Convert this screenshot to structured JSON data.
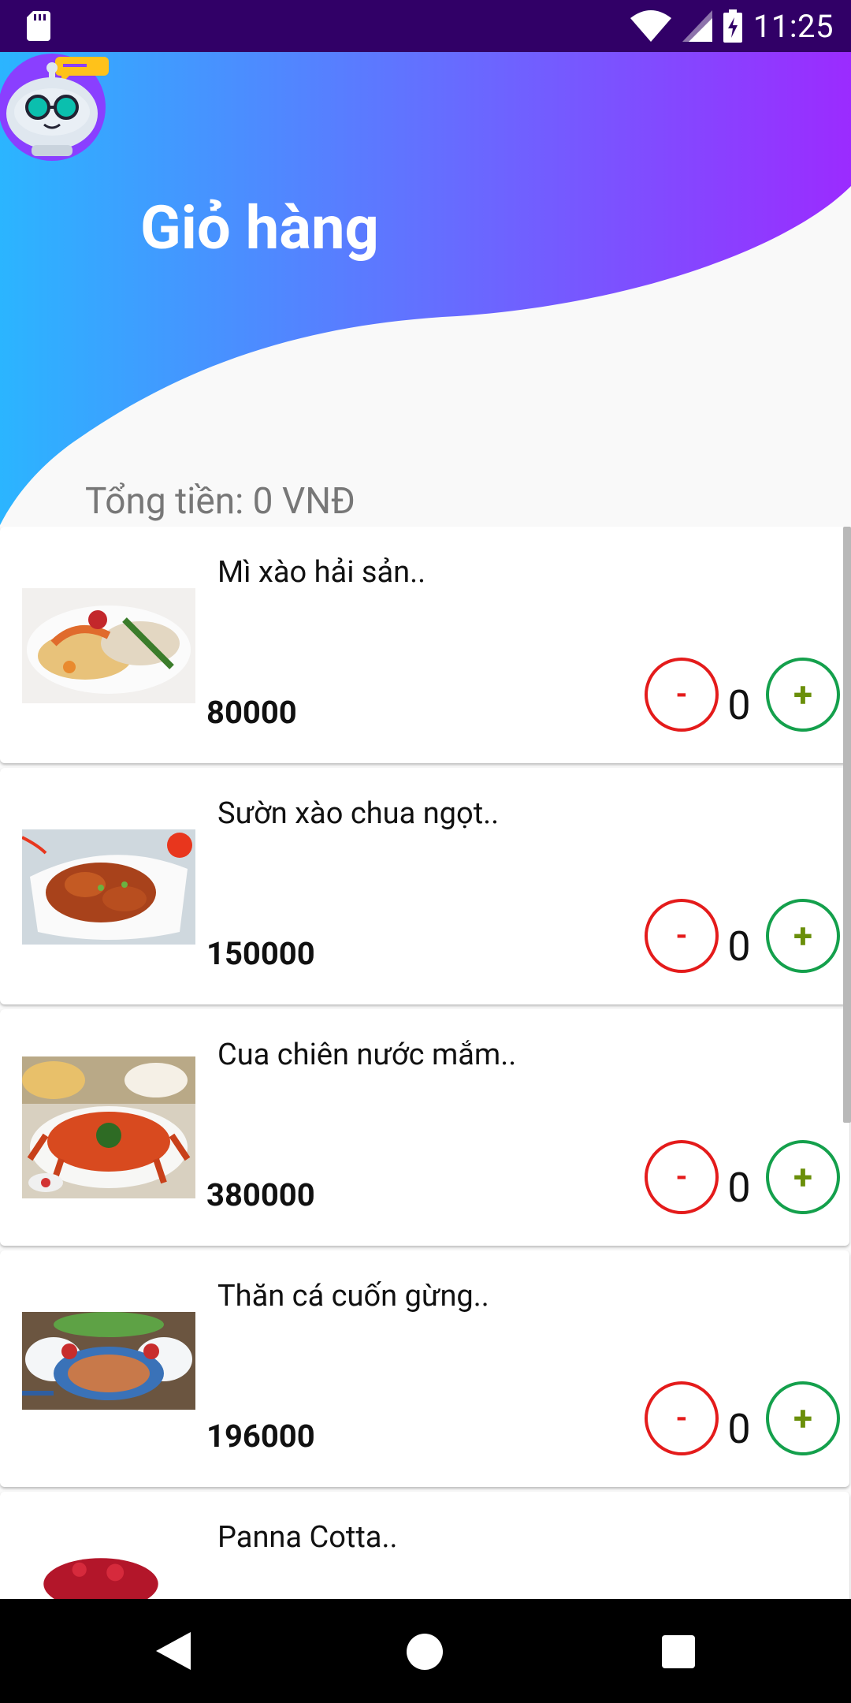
{
  "status_bar": {
    "time": "11:25"
  },
  "header": {
    "title": "Giỏ hàng",
    "total": "Tổng tiền: 0 VNĐ"
  },
  "colors": {
    "status_bar": "#310067",
    "gradient_start": "#2bb5ff",
    "gradient_end": "#9b2bff",
    "minus": "#e41b1b",
    "plus": "#14a04c"
  },
  "items": [
    {
      "name": "Mì xào hải sản..",
      "price": "80000",
      "quantity": "0",
      "minus_label": "-",
      "plus_label": "+"
    },
    {
      "name": "Sườn xào chua ngọt..",
      "price": "150000",
      "quantity": "0",
      "minus_label": "-",
      "plus_label": "+"
    },
    {
      "name": "Cua chiên nước mắm..",
      "price": "380000",
      "quantity": "0",
      "minus_label": "-",
      "plus_label": "+"
    },
    {
      "name": "Thăn cá cuốn gừng..",
      "price": "196000",
      "quantity": "0",
      "minus_label": "-",
      "plus_label": "+"
    },
    {
      "name": "Panna Cotta..",
      "price": "",
      "quantity": "",
      "minus_label": "",
      "plus_label": ""
    }
  ]
}
